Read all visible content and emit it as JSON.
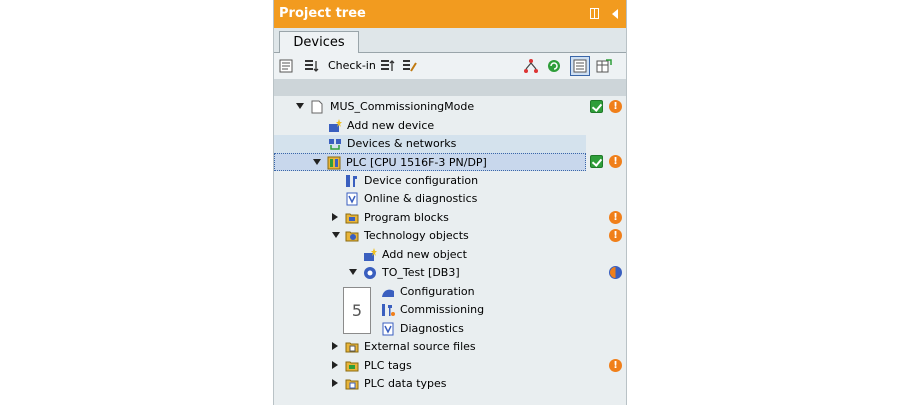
{
  "panel": {
    "title": "Project tree"
  },
  "tabs": [
    {
      "label": "Devices"
    }
  ],
  "toolbar": {
    "checkin_label": "Check-in"
  },
  "tree": {
    "project": "MUS_CommissioningMode",
    "add_new_device": "Add new device",
    "devices_networks": "Devices & networks",
    "plc": "PLC [CPU 1516F-3 PN/DP]",
    "device_configuration": "Device configuration",
    "online_diagnostics": "Online & diagnostics",
    "program_blocks": "Program blocks",
    "technology_objects": "Technology objects",
    "add_new_object": "Add new object",
    "to_test": "TO_Test [DB3]",
    "configuration": "Configuration",
    "commissioning": "Commissioning",
    "diagnostics": "Diagnostics",
    "external_source_files": "External source files",
    "plc_tags": "PLC tags",
    "plc_data_types": "PLC data types"
  },
  "callout": {
    "number": "5"
  },
  "colors": {
    "header": "#f29b1f",
    "selection": "#c8d7ec",
    "ok": "#2f9e3a",
    "warning": "#f07f1a"
  }
}
